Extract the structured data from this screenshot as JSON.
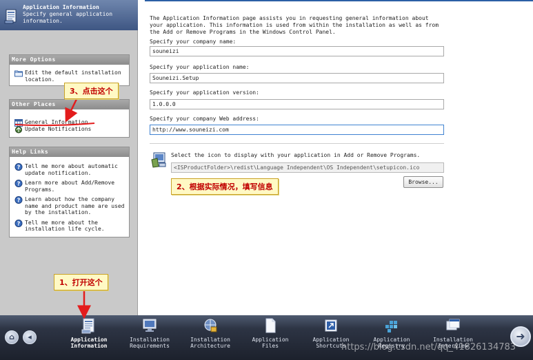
{
  "header": {
    "title": "Application Information",
    "subtitle": "Specify general application information."
  },
  "more_options": {
    "title": "More Options",
    "items": [
      {
        "label": "Edit the default installation location.",
        "icon": "folder-icon"
      }
    ]
  },
  "other_places": {
    "title": "Other Places",
    "items": [
      {
        "label": "General Information",
        "icon": "table-icon"
      },
      {
        "label": "Update Notifications",
        "icon": "update-icon"
      }
    ]
  },
  "help_links": {
    "title": "Help Links",
    "items": [
      {
        "label": "Tell me more about automatic update notification.",
        "icon": "help-icon"
      },
      {
        "label": "Learn more about Add/Remove Programs.",
        "icon": "help-icon"
      },
      {
        "label": "Learn about how the company name and product name are used by the installation.",
        "icon": "help-icon"
      },
      {
        "label": "Tell me more about the installation life cycle.",
        "icon": "help-icon"
      }
    ]
  },
  "main": {
    "intro": "The Application Information page assists you in requesting general information about your application. This information is used from within the installation as well as from the Add or Remove Programs in the Windows Control Panel.",
    "company_label": "Specify your company name:",
    "company_value": "souneizi",
    "app_name_label": "Specify your application name:",
    "app_name_value": "Souneizi.Setup",
    "version_label": "Specify your application version:",
    "version_value": "1.0.0.0",
    "web_label": "Specify your company Web address:",
    "web_value": "http://www.souneizi.com",
    "icon_label": "Select the icon to display with your application in Add or Remove Programs.",
    "icon_path": "<ISProductFolder>\\redist\\Language Independent\\OS Independent\\setupicon.ico",
    "browse_label": "Browse..."
  },
  "callouts": {
    "c1": "1、打开这个",
    "c2": "2、根据实际情况，填写信息",
    "c3": "3、点击这个"
  },
  "nav": {
    "items": [
      {
        "label": "Application\nInformation",
        "active": true
      },
      {
        "label": "Installation\nRequirements"
      },
      {
        "label": "Installation\nArchitecture"
      },
      {
        "label": "Application\nFiles"
      },
      {
        "label": "Application\nShortcuts"
      },
      {
        "label": "Application\nRegistry"
      },
      {
        "label": "Installation\nInterview"
      }
    ]
  },
  "watermark": "https://blog.csdn.net/qq_41826134783",
  "colors": {
    "accent": "#2b5fa6",
    "callout_text": "#c00000",
    "callout_bg": "#fff9c4",
    "arrow": "#e31c1c"
  }
}
